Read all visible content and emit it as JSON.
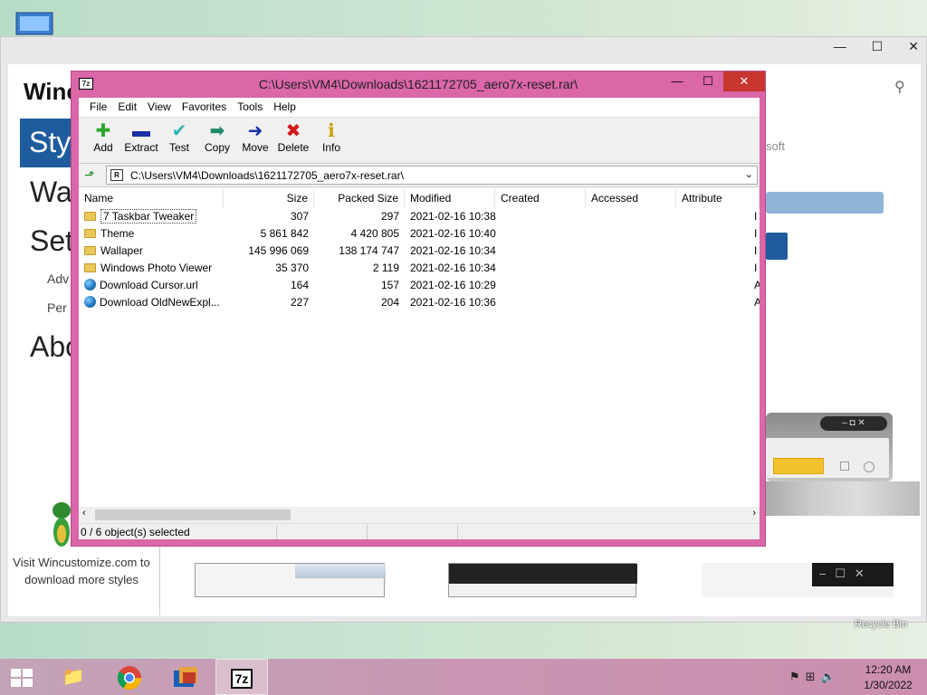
{
  "desktop": {
    "recycle_bin": "Recycle Bin"
  },
  "bg_window": {
    "heading": "Winc",
    "nav_styles": "Styl",
    "nav_wallpaper": "Wal",
    "nav_settings": "Sett",
    "nav_advanced": "Adv",
    "nav_personal": "Per",
    "nav_about": "Abo",
    "soft_text": "soft",
    "visit_text": "Visit Wincustomize.com to download more styles"
  },
  "zip": {
    "title": "C:\\Users\\VM4\\Downloads\\1621172705_aero7x-reset.rar\\",
    "logo": "7z",
    "menu": [
      "File",
      "Edit",
      "View",
      "Favorites",
      "Tools",
      "Help"
    ],
    "toolbar": [
      {
        "label": "Add",
        "icon": "plus-icon",
        "color": "#2aa52a"
      },
      {
        "label": "Extract",
        "icon": "minus-icon",
        "color": "#1a2fa8"
      },
      {
        "label": "Test",
        "icon": "check-icon",
        "color": "#2fb6b6"
      },
      {
        "label": "Copy",
        "icon": "double-arrow-icon",
        "color": "#1e8a6a"
      },
      {
        "label": "Move",
        "icon": "arrow-right-icon",
        "color": "#1a2fa8"
      },
      {
        "label": "Delete",
        "icon": "x-icon",
        "color": "#d01818"
      },
      {
        "label": "Info",
        "icon": "info-icon",
        "color": "#c8a000"
      }
    ],
    "address": "C:\\Users\\VM4\\Downloads\\1621172705_aero7x-reset.rar\\",
    "columns": [
      "Name",
      "Size",
      "Packed Size",
      "Modified",
      "Created",
      "Accessed",
      "Attribute"
    ],
    "rows": [
      {
        "type": "folder",
        "name": "7 Taskbar Tweaker",
        "size": "307",
        "packed": "297",
        "modified": "2021-02-16 10:38",
        "attr": "I"
      },
      {
        "type": "folder",
        "name": "Theme",
        "size": "5 861 842",
        "packed": "4 420 805",
        "modified": "2021-02-16 10:40",
        "attr": "I"
      },
      {
        "type": "folder",
        "name": "Wallaper",
        "size": "145 996 069",
        "packed": "138 174 747",
        "modified": "2021-02-16 10:34",
        "attr": "I"
      },
      {
        "type": "folder",
        "name": "Windows Photo Viewer",
        "size": "35 370",
        "packed": "2 119",
        "modified": "2021-02-16 10:34",
        "attr": "I"
      },
      {
        "type": "url",
        "name": "Download Cursor.url",
        "size": "164",
        "packed": "157",
        "modified": "2021-02-16 10:29",
        "attr": "A"
      },
      {
        "type": "url",
        "name": "Download OldNewExpl...",
        "size": "227",
        "packed": "204",
        "modified": "2021-02-16 10:36",
        "attr": "A"
      }
    ],
    "status": "0 / 6 object(s) selected"
  },
  "taskbar": {
    "seven_zip": "7z",
    "time": "12:20 AM",
    "date": "1/30/2022"
  }
}
